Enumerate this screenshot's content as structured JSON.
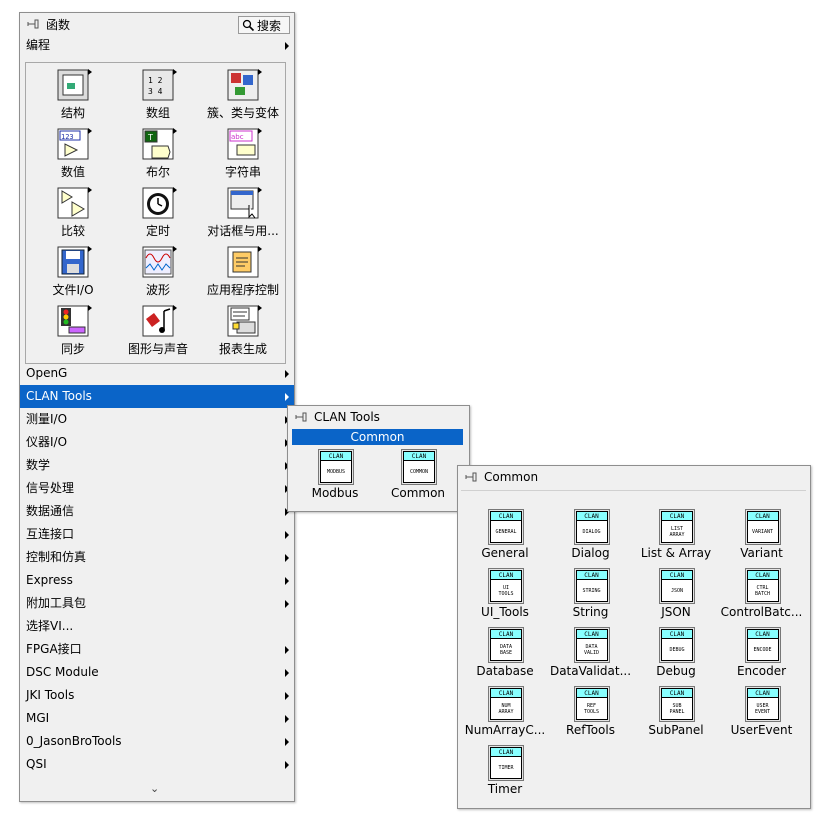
{
  "functions_palette": {
    "title": "函数",
    "search_label": "搜索",
    "section_label": "编程",
    "grid": [
      {
        "label": "结构",
        "icon": "structures-icon"
      },
      {
        "label": "数组",
        "icon": "array-icon"
      },
      {
        "label": "簇、类与变体",
        "icon": "cluster-class-variant-icon"
      },
      {
        "label": "数值",
        "icon": "numeric-icon"
      },
      {
        "label": "布尔",
        "icon": "boolean-icon"
      },
      {
        "label": "字符串",
        "icon": "string-icon"
      },
      {
        "label": "比较",
        "icon": "comparison-icon"
      },
      {
        "label": "定时",
        "icon": "timing-icon"
      },
      {
        "label": "对话框与用...",
        "icon": "dialog-ui-icon"
      },
      {
        "label": "文件I/O",
        "icon": "file-io-icon"
      },
      {
        "label": "波形",
        "icon": "waveform-icon"
      },
      {
        "label": "应用程序控制",
        "icon": "app-control-icon"
      },
      {
        "label": "同步",
        "icon": "synchronization-icon"
      },
      {
        "label": "图形与声音",
        "icon": "graphics-sound-icon"
      },
      {
        "label": "报表生成",
        "icon": "report-generation-icon"
      }
    ],
    "categories": [
      {
        "label": "OpenG",
        "has_submenu": true
      },
      {
        "label": "CLAN Tools",
        "has_submenu": true,
        "selected": true
      },
      {
        "label": "测量I/O",
        "has_submenu": true
      },
      {
        "label": "仪器I/O",
        "has_submenu": true
      },
      {
        "label": "数学",
        "has_submenu": true
      },
      {
        "label": "信号处理",
        "has_submenu": true
      },
      {
        "label": "数据通信",
        "has_submenu": true
      },
      {
        "label": "互连接口",
        "has_submenu": true
      },
      {
        "label": "控制和仿真",
        "has_submenu": true
      },
      {
        "label": "Express",
        "has_submenu": true
      },
      {
        "label": "附加工具包",
        "has_submenu": true
      },
      {
        "label": "选择VI...",
        "has_submenu": false
      },
      {
        "label": "FPGA接口",
        "has_submenu": true
      },
      {
        "label": "DSC Module",
        "has_submenu": true
      },
      {
        "label": "JKI Tools",
        "has_submenu": true
      },
      {
        "label": "MGI",
        "has_submenu": true
      },
      {
        "label": "0_JasonBroTools",
        "has_submenu": true
      },
      {
        "label": "QSI",
        "has_submenu": true
      }
    ],
    "more_glyph": "⌄"
  },
  "clan_palette": {
    "title": "CLAN Tools",
    "section_label": "Common",
    "items": [
      {
        "label": "Modbus",
        "header": "CLAN",
        "body": "MODBUS"
      },
      {
        "label": "Common",
        "header": "CLAN",
        "body": "COMMON"
      }
    ]
  },
  "common_palette": {
    "title": "Common",
    "items": [
      {
        "label": "General",
        "header": "CLAN",
        "body": "GENERAL"
      },
      {
        "label": "Dialog",
        "header": "CLAN",
        "body": "DIALOG"
      },
      {
        "label": "List & Array",
        "header": "CLAN",
        "body": "LIST\nARRAY"
      },
      {
        "label": "Variant",
        "header": "CLAN",
        "body": "VARIANT"
      },
      {
        "label": "UI_Tools",
        "header": "CLAN",
        "body": "UI\nTOOLS"
      },
      {
        "label": "String",
        "header": "CLAN",
        "body": "STRING"
      },
      {
        "label": "JSON",
        "header": "CLAN",
        "body": "JSON"
      },
      {
        "label": "ControlBatc...",
        "header": "CLAN",
        "body": "CTRL\nBATCH"
      },
      {
        "label": "Database",
        "header": "CLAN",
        "body": "DATA\nBASE"
      },
      {
        "label": "DataValidat...",
        "header": "CLAN",
        "body": "DATA\nVALID"
      },
      {
        "label": "Debug",
        "header": "CLAN",
        "body": "DEBUG"
      },
      {
        "label": "Encoder",
        "header": "CLAN",
        "body": "ENCODE"
      },
      {
        "label": "NumArrayC...",
        "header": "CLAN",
        "body": "NUM\nARRAY"
      },
      {
        "label": "RefTools",
        "header": "CLAN",
        "body": "REF\nTOOLS"
      },
      {
        "label": "SubPanel",
        "header": "CLAN",
        "body": "SUB\nPANEL"
      },
      {
        "label": "UserEvent",
        "header": "CLAN",
        "body": "USER\nEVENT"
      },
      {
        "label": "Timer",
        "header": "CLAN",
        "body": "TIMER"
      }
    ]
  },
  "colors": {
    "selection": "#0a64c8",
    "panel_bg": "#f0f0f0",
    "clan_header": "#88ffff"
  }
}
